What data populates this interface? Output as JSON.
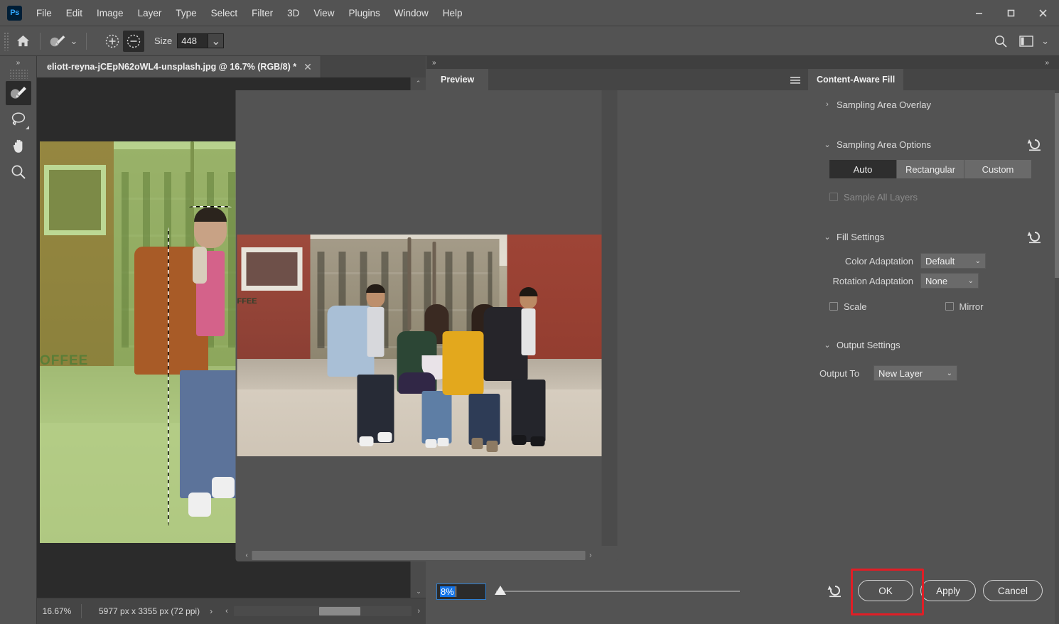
{
  "app": {
    "logo_text": "Ps"
  },
  "menubar": {
    "items": [
      {
        "label": "File"
      },
      {
        "label": "Edit"
      },
      {
        "label": "Image"
      },
      {
        "label": "Layer"
      },
      {
        "label": "Type"
      },
      {
        "label": "Select"
      },
      {
        "label": "Filter"
      },
      {
        "label": "3D"
      },
      {
        "label": "View"
      },
      {
        "label": "Plugins"
      },
      {
        "label": "Window"
      },
      {
        "label": "Help"
      }
    ],
    "window_controls": {
      "minimize": "—",
      "maximize": "☐",
      "close": "✕"
    }
  },
  "options_bar": {
    "home_icon": "home-icon",
    "brush_icon": "sampling-brush-icon",
    "brush_dropdown_caret": "⌄",
    "add_to_selection_icon": "add-to-sampling-area-icon",
    "subtract_from_selection_icon": "subtract-from-sampling-area-icon",
    "size_label": "Size",
    "size_value": "448",
    "size_dropdown_caret": "⌄",
    "search_icon": "search-icon",
    "workspace_icon": "workspace-switcher-icon",
    "workspace_caret": "⌄"
  },
  "toolbar": {
    "collapse_icon": "»",
    "tools": [
      {
        "name": "sampling-brush-tool",
        "active": true
      },
      {
        "name": "lasso-tool",
        "active": false
      },
      {
        "name": "hand-tool",
        "active": false
      },
      {
        "name": "zoom-tool",
        "active": false
      }
    ]
  },
  "document": {
    "tab_title": "eliott-reyna-jCEpN62oWL4-unsplash.jpg @ 16.7% (RGB/8) *",
    "close_glyph": "✕",
    "canvas_text": "OFFEE",
    "status": {
      "zoom": "16.67%",
      "dimensions": "5977 px x 3355 px (72 ppi)",
      "expand_glyph": "›",
      "left_arrow": "‹",
      "right_arrow": "›"
    },
    "scroll": {
      "up_arrow": "⌃",
      "down_arrow": "⌄"
    }
  },
  "preview": {
    "collapse_icon": "»",
    "tab_label": "Preview",
    "menu_icon": "panel-menu-icon",
    "zoom_value": "8%",
    "scroll_left_arrow": "‹",
    "scroll_right_arrow": "›"
  },
  "content_aware_fill": {
    "collapse_icon": "»",
    "tab_label": "Content-Aware Fill",
    "sections": {
      "sampling_area_overlay": {
        "title": "Sampling Area Overlay",
        "chevron": "›",
        "expanded": false
      },
      "sampling_area_options": {
        "title": "Sampling Area Options",
        "chevron": "⌄",
        "reset_icon": "reset-icon",
        "segments": [
          {
            "label": "Auto",
            "active": true
          },
          {
            "label": "Rectangular",
            "active": false
          },
          {
            "label": "Custom",
            "active": false
          }
        ],
        "sample_all_layers": {
          "label": "Sample All Layers",
          "checked": false,
          "disabled": true
        }
      },
      "fill_settings": {
        "title": "Fill Settings",
        "chevron": "⌄",
        "reset_icon": "reset-icon",
        "color_adaptation": {
          "label": "Color Adaptation",
          "value": "Default",
          "caret": "⌄"
        },
        "rotation_adaptation": {
          "label": "Rotation Adaptation",
          "value": "None",
          "caret": "⌄"
        },
        "scale": {
          "label": "Scale",
          "checked": false
        },
        "mirror": {
          "label": "Mirror",
          "checked": false
        }
      },
      "output_settings": {
        "title": "Output Settings",
        "chevron": "⌄",
        "output_to": {
          "label": "Output To",
          "value": "New Layer",
          "caret": "⌄"
        }
      }
    },
    "footer": {
      "reset_icon": "reset-icon",
      "ok_label": "OK",
      "apply_label": "Apply",
      "cancel_label": "Cancel"
    }
  },
  "annotation": {
    "highlight_color": "#e01e26",
    "highlight_target": "ok-button"
  },
  "colors": {
    "panel_bg": "#535353",
    "dark_bg": "#454545",
    "canvas_bg": "#2b2b2b",
    "accent_blue": "#1473e6",
    "sampling_overlay_green": "#8ccd46"
  }
}
